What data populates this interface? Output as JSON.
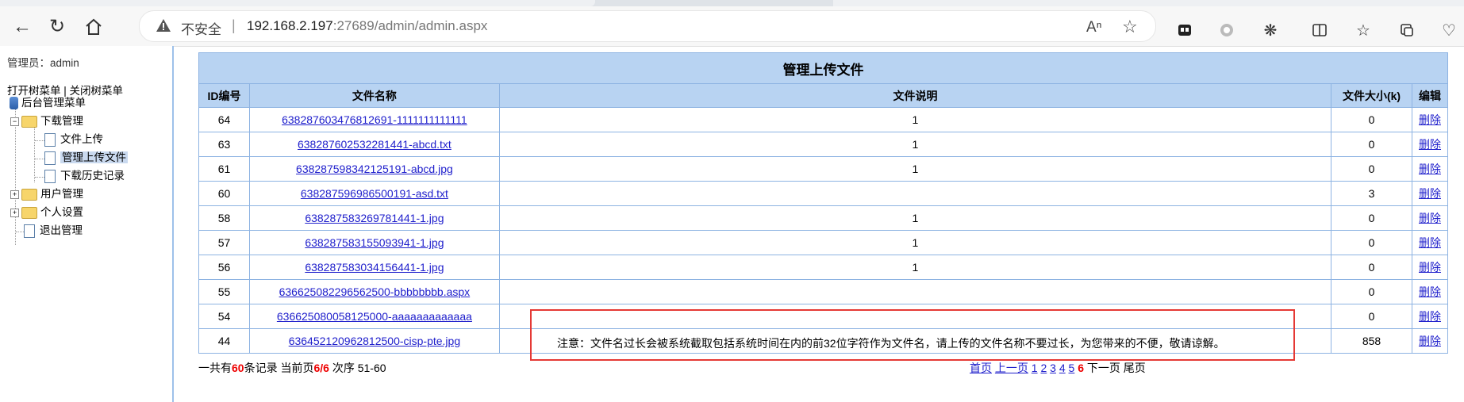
{
  "browser": {
    "insecure_label": "不安全",
    "separator": "|",
    "url_host": "192.168.2.197",
    "url_port_path": ":27689/admin/admin.aspx"
  },
  "sidebar": {
    "admin_label": "管理员：admin",
    "open_tree": "打开树菜单",
    "divider": "|",
    "close_tree": "关闭树菜单",
    "root": "后台管理菜单",
    "nodes": [
      {
        "label": "下载管理"
      },
      {
        "label": "文件上传"
      },
      {
        "label": "管理上传文件"
      },
      {
        "label": "下载历史记录"
      },
      {
        "label": "用户管理"
      },
      {
        "label": "个人设置"
      },
      {
        "label": "退出管理"
      }
    ]
  },
  "table": {
    "caption": "管理上传文件",
    "headers": [
      "ID编号",
      "文件名称",
      "文件说明",
      "文件大小(k)",
      "编辑"
    ],
    "rows": [
      {
        "id": "64",
        "name": "638287603476812691-1111111111111",
        "desc": "1",
        "size": "0",
        "action": "删除"
      },
      {
        "id": "63",
        "name": "638287602532281441-abcd.txt",
        "desc": "1",
        "size": "0",
        "action": "删除"
      },
      {
        "id": "61",
        "name": "638287598342125191-abcd.jpg",
        "desc": "1",
        "size": "0",
        "action": "删除"
      },
      {
        "id": "60",
        "name": "638287596986500191-asd.txt",
        "desc": "",
        "size": "3",
        "action": "删除"
      },
      {
        "id": "58",
        "name": "638287583269781441-1.jpg",
        "desc": "1",
        "size": "0",
        "action": "删除"
      },
      {
        "id": "57",
        "name": "638287583155093941-1.jpg",
        "desc": "1",
        "size": "0",
        "action": "删除"
      },
      {
        "id": "56",
        "name": "638287583034156441-1.jpg",
        "desc": "1",
        "size": "0",
        "action": "删除"
      },
      {
        "id": "55",
        "name": "636625082296562500-bbbbbbbb.aspx",
        "desc": "",
        "size": "0",
        "action": "删除"
      },
      {
        "id": "54",
        "name": "636625080058125000-aaaaaaaaaaaaa",
        "desc": "",
        "size": "0",
        "action": "删除"
      },
      {
        "id": "44",
        "name": "636452120962812500-cisp-pte.jpg",
        "desc": "",
        "size": "858",
        "action": "删除"
      }
    ]
  },
  "pager": {
    "total_prefix": "一共有",
    "total": "60",
    "total_suffix": "条记录 当前页",
    "current": "6/6",
    "range": " 次序 51-60",
    "first": "首页",
    "prev": "上一页",
    "pages": [
      "1",
      "2",
      "3",
      "4",
      "5"
    ],
    "current_page": "6",
    "next": "下一页",
    "last": "尾页"
  },
  "notice": "注意：文件名过长会被系统截取包括系统时间在内的前32位字符作为文件名，请上传的文件名称不要过长，为您带来的不便，敬请谅解。",
  "colors": {
    "header_bg": "#b8d3f2",
    "border": "#8db3e2",
    "link": "#2020cc",
    "highlight": "#e53935"
  }
}
